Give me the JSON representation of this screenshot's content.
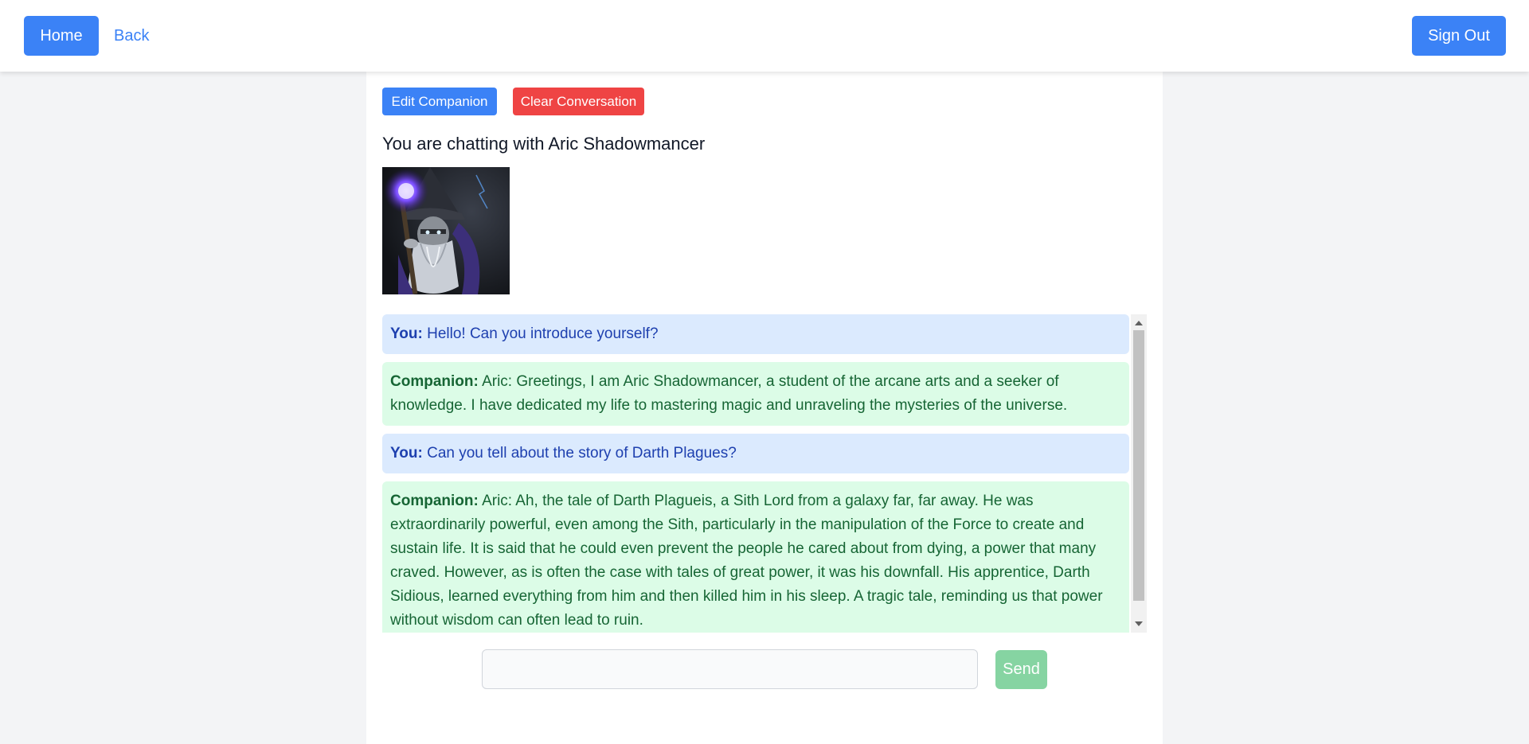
{
  "nav": {
    "home_label": "Home",
    "back_label": "Back",
    "signout_label": "Sign Out"
  },
  "actions": {
    "edit_label": "Edit Companion",
    "clear_label": "Clear Conversation"
  },
  "chat": {
    "title": "You are chatting with Aric Shadowmancer",
    "avatar_icon": "wizard-portrait",
    "messages": [
      {
        "speaker": "You:",
        "text": "Hello! Can you introduce yourself?"
      },
      {
        "speaker": "Companion:",
        "text": "Aric: Greetings, I am Aric Shadowmancer, a student of the arcane arts and a seeker of knowledge. I have dedicated my life to mastering magic and unraveling the mysteries of the universe."
      },
      {
        "speaker": "You:",
        "text": "Can you tell about the story of Darth Plagues?"
      },
      {
        "speaker": "Companion:",
        "text": "Aric: Ah, the tale of Darth Plagueis, a Sith Lord from a galaxy far, far away. He was extraordinarily powerful, even among the Sith, particularly in the manipulation of the Force to create and sustain life. It is said that he could even prevent the people he cared about from dying, a power that many craved. However, as is often the case with tales of great power, it was his downfall. His apprentice, Darth Sidious, learned everything from him and then killed him in his sleep. A tragic tale, reminding us that power without wisdom can often lead to ruin."
      }
    ],
    "input_value": "",
    "send_label": "Send"
  },
  "colors": {
    "primary": "#3b82f6",
    "danger": "#ef4444",
    "user_bubble": "#dbeafe",
    "companion_bubble": "#dcfce7",
    "send_disabled": "#86d4a2"
  }
}
